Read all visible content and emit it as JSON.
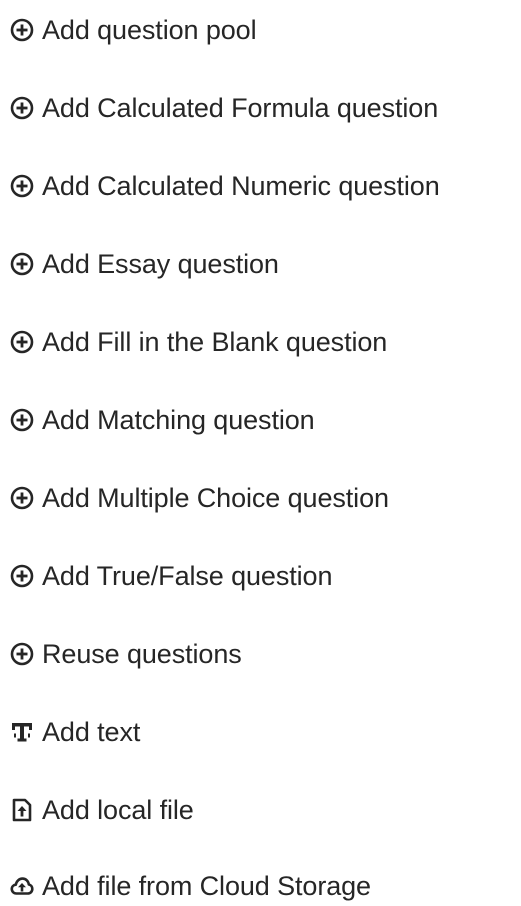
{
  "menu": {
    "items": [
      {
        "label": "Add question pool",
        "icon": "plus-circle-icon"
      },
      {
        "label": "Add Calculated Formula question",
        "icon": "plus-circle-icon"
      },
      {
        "label": "Add Calculated Numeric question",
        "icon": "plus-circle-icon"
      },
      {
        "label": "Add Essay question",
        "icon": "plus-circle-icon"
      },
      {
        "label": "Add Fill in the Blank question",
        "icon": "plus-circle-icon"
      },
      {
        "label": "Add Matching question",
        "icon": "plus-circle-icon"
      },
      {
        "label": "Add Multiple Choice question",
        "icon": "plus-circle-icon"
      },
      {
        "label": "Add True/False question",
        "icon": "plus-circle-icon"
      },
      {
        "label": "Reuse questions",
        "icon": "plus-circle-icon"
      },
      {
        "label": "Add text",
        "icon": "text-icon"
      },
      {
        "label": "Add local file",
        "icon": "file-upload-icon"
      },
      {
        "label": "Add file from Cloud Storage",
        "icon": "cloud-upload-icon"
      }
    ]
  },
  "colors": {
    "text": "#262626",
    "background": "#ffffff"
  }
}
